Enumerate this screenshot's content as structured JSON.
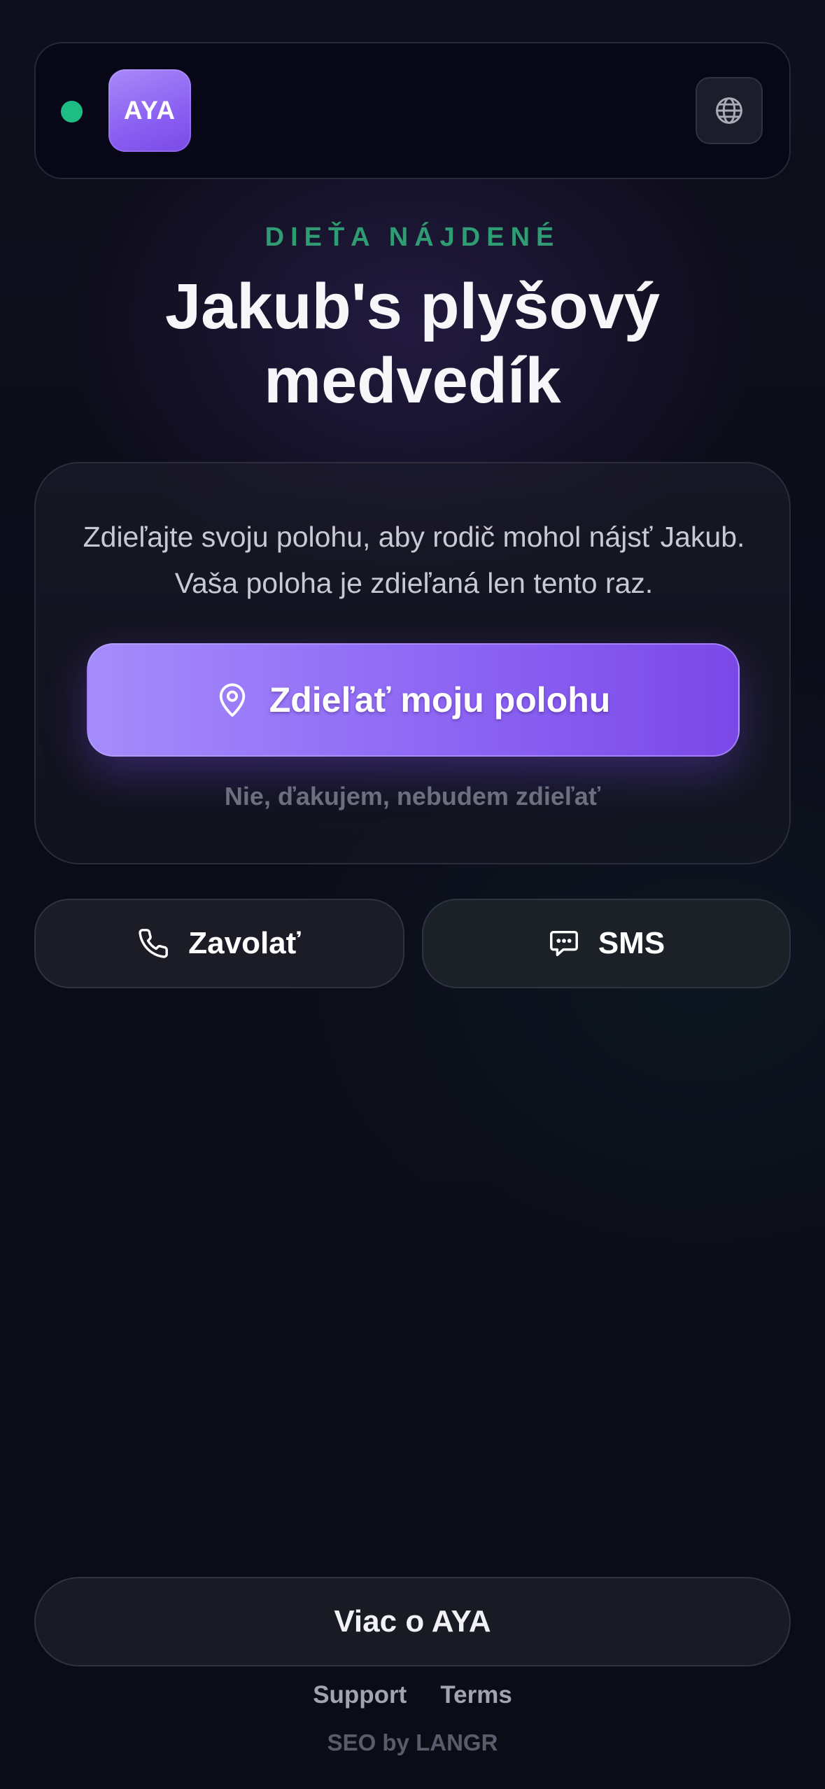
{
  "header": {
    "logo_text": "AYA",
    "status": "online",
    "status_color": "#1fbd86",
    "language_icon": "globe-icon"
  },
  "hero": {
    "eyebrow": "DIEŤA NÁJDENÉ",
    "title": "Jakub's plyšový medvedík"
  },
  "location_card": {
    "description": "Zdieľajte svoju polohu, aby rodič mohol nájsť Jakub. Vaša poloha je zdieľaná len tento raz.",
    "share_button_label": "Zdieľať moju polohu",
    "share_button_icon": "location-pin-icon",
    "decline_label": "Nie, ďakujem, nebudem zdieľať"
  },
  "contact": {
    "call_label": "Zavolať",
    "call_icon": "phone-icon",
    "sms_label": "SMS",
    "sms_icon": "chat-bubble-icon"
  },
  "footer": {
    "more_label": "Viac o AYA",
    "links": [
      "Support",
      "Terms"
    ],
    "credit": "SEO by LANGR"
  },
  "colors": {
    "accent_purple": "#8d66f4",
    "accent_green": "#2f9c73",
    "background": "#0c0c19"
  }
}
